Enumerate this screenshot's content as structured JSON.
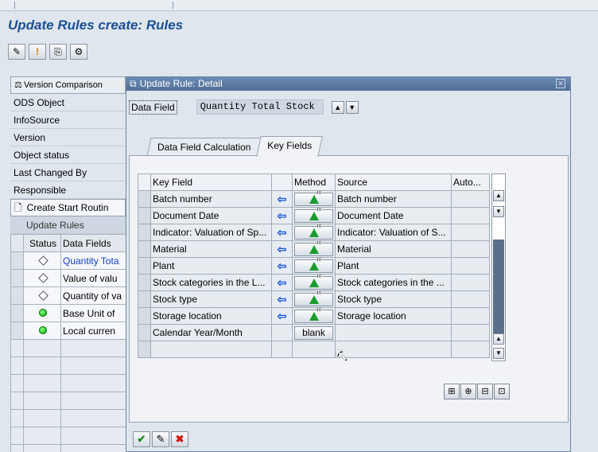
{
  "screen": {
    "title": "Update Rules create: Rules"
  },
  "toolbar": {
    "icons": [
      "change-icon",
      "info-icon",
      "copy-icon",
      "settings-icon"
    ]
  },
  "left": {
    "version_comparison": "Version Comparison",
    "fields": [
      "ODS Object",
      "InfoSource",
      "Version",
      "Object status",
      "Last Changed By",
      "Responsible"
    ],
    "create_start_routine": "Create Start Routin",
    "update_rules": "Update Rules",
    "table": {
      "headers": [
        "Status",
        "Data Fields"
      ],
      "rows": [
        {
          "status": "diamond",
          "field": "Quantity Tota"
        },
        {
          "status": "diamond",
          "field": "Value of valu"
        },
        {
          "status": "diamond",
          "field": "Quantity of va"
        },
        {
          "status": "green",
          "field": "Base Unit of"
        },
        {
          "status": "green",
          "field": "Local curren"
        }
      ]
    }
  },
  "dialog": {
    "title": "Update Rule: Detail",
    "data_field_label": "Data Field",
    "data_field_value": "Quantity Total Stock",
    "tabs": [
      "Data Field Calculation",
      "Key Fields"
    ],
    "active_tab": "Key Fields",
    "grid": {
      "headers": {
        "key_field": "Key Field",
        "method": "Method",
        "source": "Source",
        "auto": "Auto..."
      },
      "rows": [
        {
          "key": "Batch number",
          "arrow": "⇦",
          "method": "icon",
          "source": "Batch number"
        },
        {
          "key": "Document Date",
          "arrow": "⇦",
          "method": "icon",
          "source": "Document Date"
        },
        {
          "key": "Indicator: Valuation of Sp...",
          "arrow": "⇦",
          "method": "icon",
          "source": "Indicator: Valuation of S..."
        },
        {
          "key": "Material",
          "arrow": "⇦",
          "method": "icon",
          "source": "Material"
        },
        {
          "key": "Plant",
          "arrow": "⇦",
          "method": "icon",
          "source": "Plant"
        },
        {
          "key": "Stock categories in the L...",
          "arrow": "⇦",
          "method": "icon",
          "source": "Stock categories in the ..."
        },
        {
          "key": "Stock type",
          "arrow": "⇦",
          "method": "icon",
          "source": "Stock type"
        },
        {
          "key": "Storage location",
          "arrow": "⇦",
          "method": "icon",
          "source": "Storage location"
        },
        {
          "key": "Calendar Year/Month",
          "arrow": "",
          "method": "blank",
          "source": ""
        }
      ]
    }
  },
  "colors": {
    "title": "#1d4f91",
    "dialog_header": "#5b7ba4",
    "link": "#1540c8",
    "arrow": "#1a57d8"
  }
}
